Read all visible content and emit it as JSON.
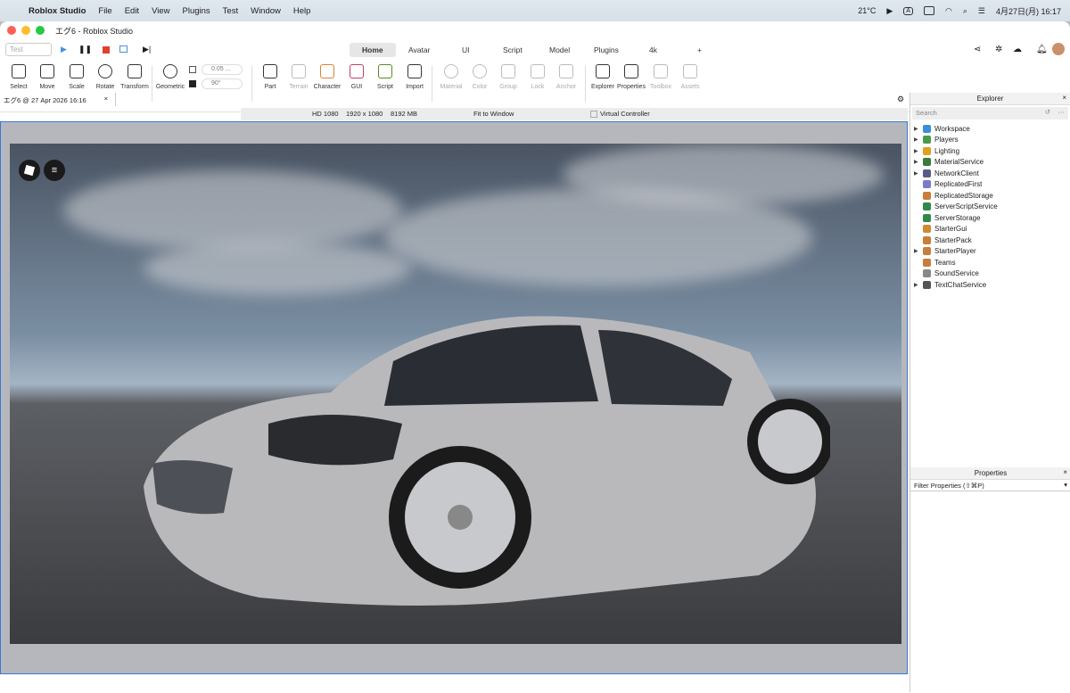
{
  "menubar": {
    "app": "Roblox Studio",
    "menus": [
      "File",
      "Edit",
      "View",
      "Plugins",
      "Test",
      "Window",
      "Help"
    ],
    "weather": "21°C",
    "input": "A",
    "datetime": "4月27日(月) 16:17"
  },
  "window": {
    "title": "エグ6 - Roblox Studio"
  },
  "ribbon": {
    "test_select": "Test",
    "tabs": [
      "Home",
      "Avatar",
      "UI",
      "Script",
      "Model",
      "Plugins",
      "4k"
    ],
    "active_tab": "Home",
    "tools": [
      "Select",
      "Move",
      "Scale",
      "Rotate",
      "Transform",
      "Geometric"
    ],
    "snap_move": "0.05 ...",
    "snap_rotate": "90°",
    "insert": [
      "Part",
      "Terrain",
      "Character",
      "GUI",
      "Script",
      "Import"
    ],
    "edit": [
      "Material",
      "Color",
      "Group",
      "Lock",
      "Anchor"
    ],
    "panels": [
      "Explorer",
      "Properties",
      "Toolbox",
      "Assets"
    ]
  },
  "doc_tab": "エグ6 @ 27 Apr 2026 16:16",
  "viewport_bar": {
    "device": "HD 1080",
    "resolution": "1920 x 1080",
    "memory": "8192 MB",
    "fit": "Fit to Window",
    "virtual_controller": "Virtual Controller"
  },
  "explorer": {
    "title": "Explorer",
    "search_placeholder": "Search",
    "items": [
      {
        "label": "Workspace",
        "expand": true,
        "color": "#3a8fd6"
      },
      {
        "label": "Players",
        "expand": true,
        "color": "#4a9a4a"
      },
      {
        "label": "Lighting",
        "expand": true,
        "color": "#e0a020"
      },
      {
        "label": "MaterialService",
        "expand": true,
        "color": "#3a7a3a"
      },
      {
        "label": "NetworkClient",
        "expand": true,
        "color": "#5a5a8a"
      },
      {
        "label": "ReplicatedFirst",
        "expand": false,
        "color": "#7a7acc"
      },
      {
        "label": "ReplicatedStorage",
        "expand": false,
        "color": "#c87d3a"
      },
      {
        "label": "ServerScriptService",
        "expand": false,
        "color": "#2e8a4a"
      },
      {
        "label": "ServerStorage",
        "expand": false,
        "color": "#2e8a4a"
      },
      {
        "label": "StarterGui",
        "expand": false,
        "color": "#d08a30"
      },
      {
        "label": "StarterPack",
        "expand": false,
        "color": "#c87d3a"
      },
      {
        "label": "StarterPlayer",
        "expand": true,
        "color": "#c87d3a"
      },
      {
        "label": "Teams",
        "expand": false,
        "color": "#c87d3a"
      },
      {
        "label": "SoundService",
        "expand": false,
        "color": "#888888"
      },
      {
        "label": "TextChatService",
        "expand": true,
        "color": "#555555"
      }
    ]
  },
  "properties": {
    "title": "Properties",
    "filter_placeholder": "Filter Properties (⇧⌘P)"
  }
}
